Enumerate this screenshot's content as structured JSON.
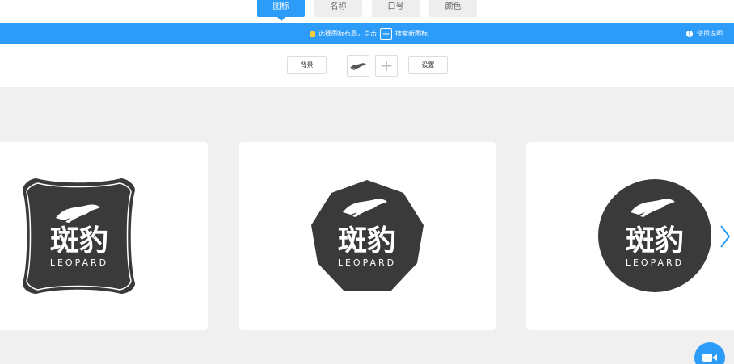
{
  "tabs": [
    {
      "label": "图标",
      "active": true
    },
    {
      "label": "名称",
      "active": false
    },
    {
      "label": "口号",
      "active": false
    },
    {
      "label": "颜色",
      "active": false
    }
  ],
  "infobar": {
    "hint_before": "选择图标布局，点击",
    "hint_plus": "+",
    "hint_after": "搜索新图标",
    "help": "使用说明"
  },
  "toolbar": {
    "background_label": "背景",
    "settings_label": "设置",
    "add_label": "+"
  },
  "logos": [
    {
      "shape": "bracket-square",
      "cn": "斑豹",
      "en": "LEOPARD"
    },
    {
      "shape": "nonagon",
      "cn": "斑豹",
      "en": "LEOPARD"
    },
    {
      "shape": "circle",
      "cn": "斑豹",
      "en": "LEOPARD"
    }
  ],
  "colors": {
    "accent": "#2d9cf8",
    "logo_fill": "#3a3a3a",
    "canvas": "#f0f0f0"
  },
  "icons": [
    "bulb-icon",
    "info-icon",
    "leopard-icon",
    "chevron-left-icon",
    "chevron-right-icon",
    "video-camera-icon"
  ]
}
